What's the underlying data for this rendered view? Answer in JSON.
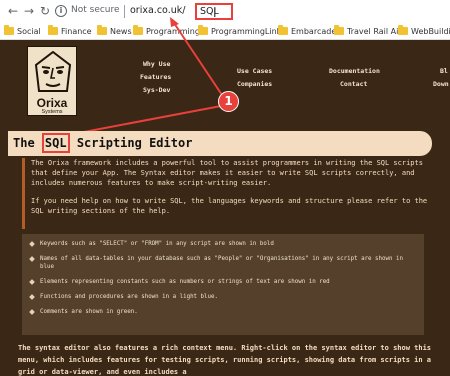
{
  "browser": {
    "not_secure": "Not secure",
    "url_host": "orixa.co.uk/",
    "url_path": "SQL"
  },
  "bookmarks": [
    "Social",
    "Finance",
    "News",
    "Programming",
    "ProgrammingLinks",
    "Embarcadero",
    "Travel Rail Air",
    "WebBuilding"
  ],
  "logo": {
    "name": "Orixa",
    "sub": "Systems"
  },
  "menu": {
    "col1": [
      "Why Use",
      "Features",
      "Sys-Dev"
    ],
    "col2": [
      "Use Cases",
      "Companies"
    ],
    "col3": [
      "Documentation",
      "Contact"
    ],
    "col4": [
      "Bl",
      "Down"
    ]
  },
  "annotation": {
    "number": "1"
  },
  "page": {
    "title_pre": "The ",
    "title_sql": "SQL",
    "title_post": " Scripting Editor",
    "intro": [
      "The Orixa framework includes a powerful tool to assist programmers in writing the SQL scripts that define your App. The Syntax editor makes it easier to write SQL scripts correctly, and includes numerous features to make script-writing easier.",
      "If you need help on how to write SQL, the languages keywords and structure please refer to the SQL writing sections of the help."
    ],
    "bullets": [
      "Keywords such as \"SELECT\" or \"FROM\" in any script are shown in bold",
      "Names of all data-tables in your database such as \"People\" or \"Organisations\" in any script are shown in blue",
      "Elements representing constants such as numbers or strings of text are shown in red",
      "Functions and procedures are shown in a light blue.",
      "Comments are shown in green."
    ],
    "outro": "The syntax editor also features a rich context menu. Right-click on the syntax editor to show this menu, which includes features for testing scripts, running scripts, showing data from scripts in a grid or data-viewer, and even includes a"
  },
  "colors": {
    "page_bg": "#3b2716",
    "accent": "#b35c28",
    "title_bar": "#f4dcc0",
    "panel": "#55402b",
    "annotation": "#e8403a"
  }
}
